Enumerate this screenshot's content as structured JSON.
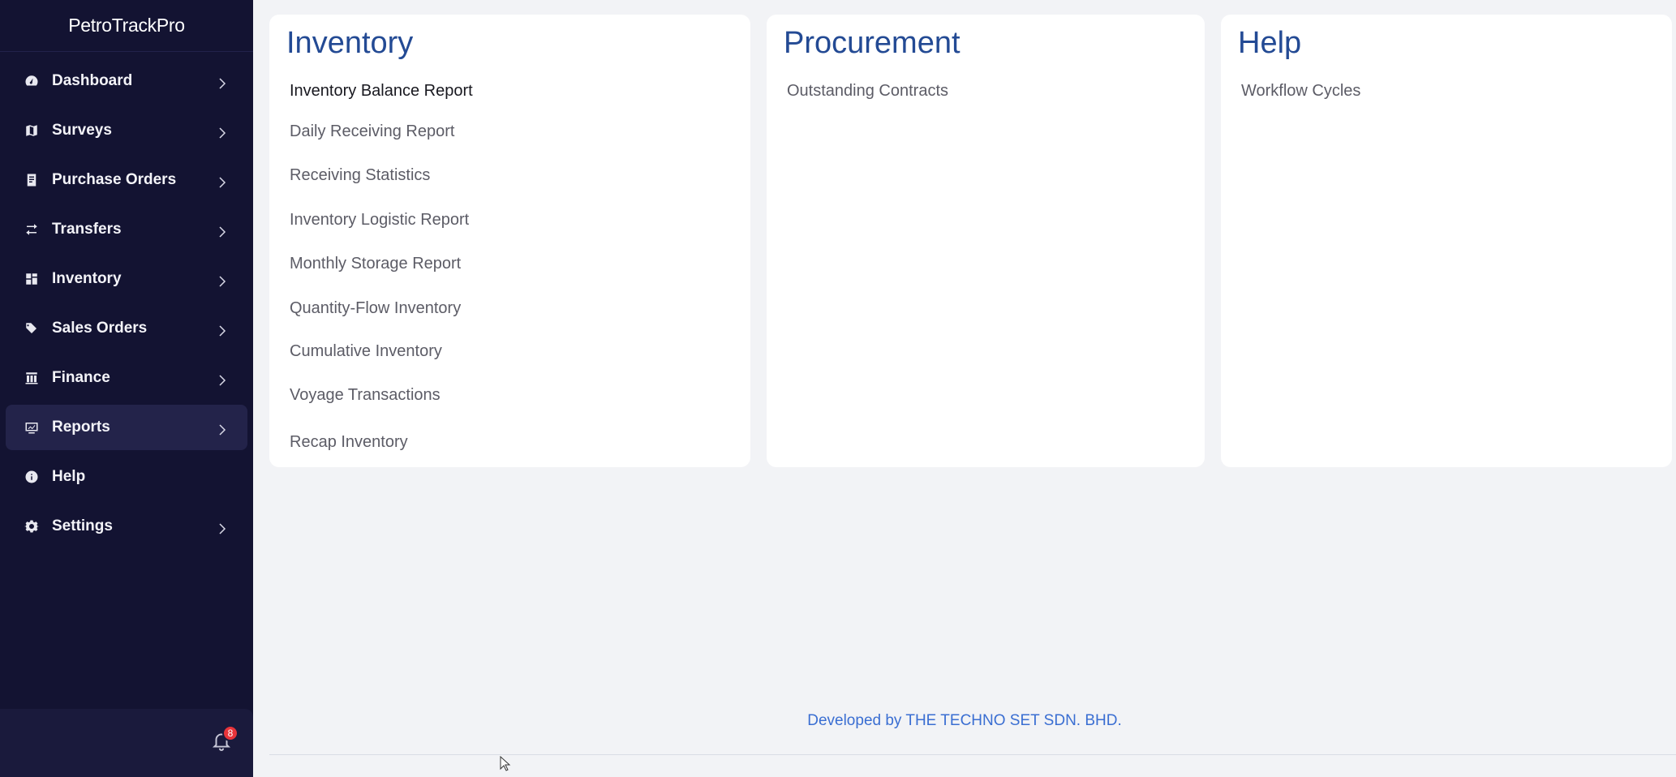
{
  "sidebar": {
    "brand": "PetroTrackPro",
    "items": [
      {
        "label": "Dashboard",
        "icon": "dashboard-icon",
        "has_chevron": true
      },
      {
        "label": "Surveys",
        "icon": "map-icon",
        "has_chevron": true
      },
      {
        "label": "Purchase Orders",
        "icon": "document-list-icon",
        "has_chevron": true
      },
      {
        "label": "Transfers",
        "icon": "transfer-arrows-icon",
        "has_chevron": true
      },
      {
        "label": "Inventory",
        "icon": "warehouse-icon",
        "has_chevron": true
      },
      {
        "label": "Sales Orders",
        "icon": "tags-icon",
        "has_chevron": true
      },
      {
        "label": "Finance",
        "icon": "bank-icon",
        "has_chevron": true
      },
      {
        "label": "Reports",
        "icon": "chart-icon",
        "has_chevron": true,
        "active": true
      },
      {
        "label": "Help",
        "icon": "info-icon",
        "has_chevron": false
      },
      {
        "label": "Settings",
        "icon": "gear-icon",
        "has_chevron": true
      }
    ],
    "notifications": {
      "count": "8",
      "icon": "bell-icon"
    }
  },
  "cards": {
    "inventory": {
      "title": "Inventory",
      "links": [
        "Inventory Balance Report",
        "Daily Receiving Report",
        "Receiving Statistics",
        "Inventory Logistic Report",
        "Monthly Storage Report",
        "Quantity-Flow Inventory",
        "Cumulative Inventory",
        "Voyage Transactions",
        "Recap Inventory"
      ]
    },
    "procurement": {
      "title": "Procurement",
      "links": [
        "Outstanding Contracts"
      ]
    },
    "help": {
      "title": "Help",
      "links": [
        "Workflow Cycles"
      ]
    }
  },
  "footer": {
    "text": "Developed by THE TECHNO SET SDN. BHD."
  },
  "colors": {
    "sidebar_bg": "#131332",
    "sidebar_active": "#23234a",
    "card_title": "#234a94",
    "footer_link": "#3a6ed2",
    "badge": "#e8343a"
  }
}
